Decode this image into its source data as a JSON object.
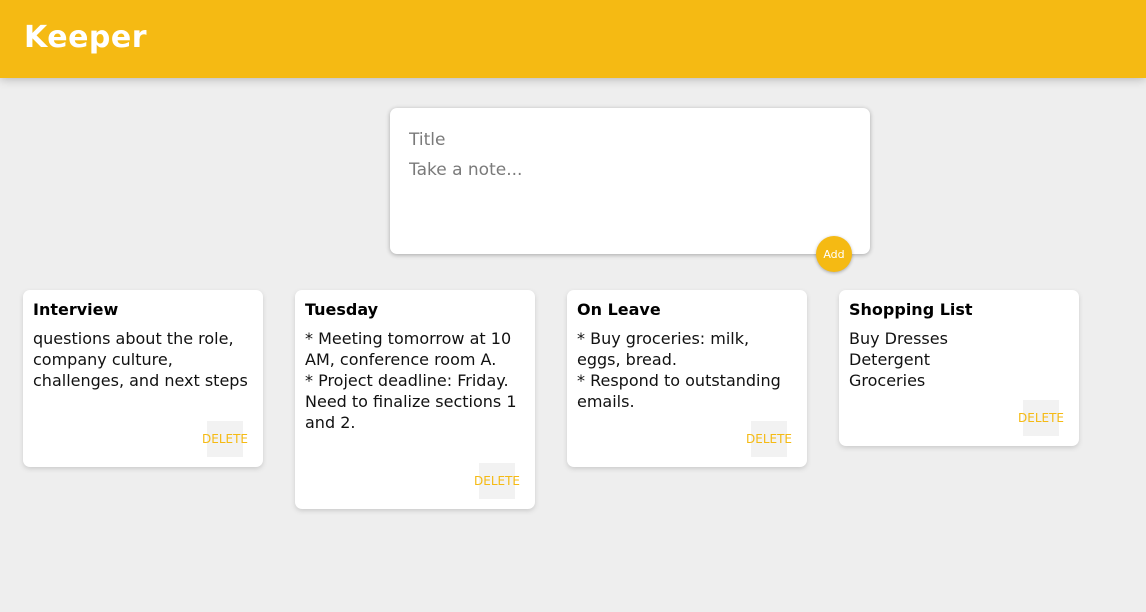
{
  "header": {
    "title": "Keeper"
  },
  "create_note": {
    "title_placeholder": "Title",
    "content_placeholder": "Take a note...",
    "add_label": "Add"
  },
  "notes": [
    {
      "title": "Interview",
      "content": "questions about the role, company culture, challenges, and next steps",
      "delete_label": "DELETE"
    },
    {
      "title": "Tuesday",
      "content": "* Meeting tomorrow at 10 AM, conference room A.\n* Project deadline: Friday. Need to finalize sections 1 and 2.",
      "delete_label": "DELETE"
    },
    {
      "title": "On Leave",
      "content": "* Buy groceries: milk, eggs, bread.\n* Respond to outstanding emails.",
      "delete_label": "DELETE"
    },
    {
      "title": "Shopping List",
      "content": "Buy Dresses\nDetergent\nGroceries",
      "delete_label": "DELETE"
    }
  ],
  "colors": {
    "accent": "#f5ba13",
    "background": "#eeeeee"
  }
}
